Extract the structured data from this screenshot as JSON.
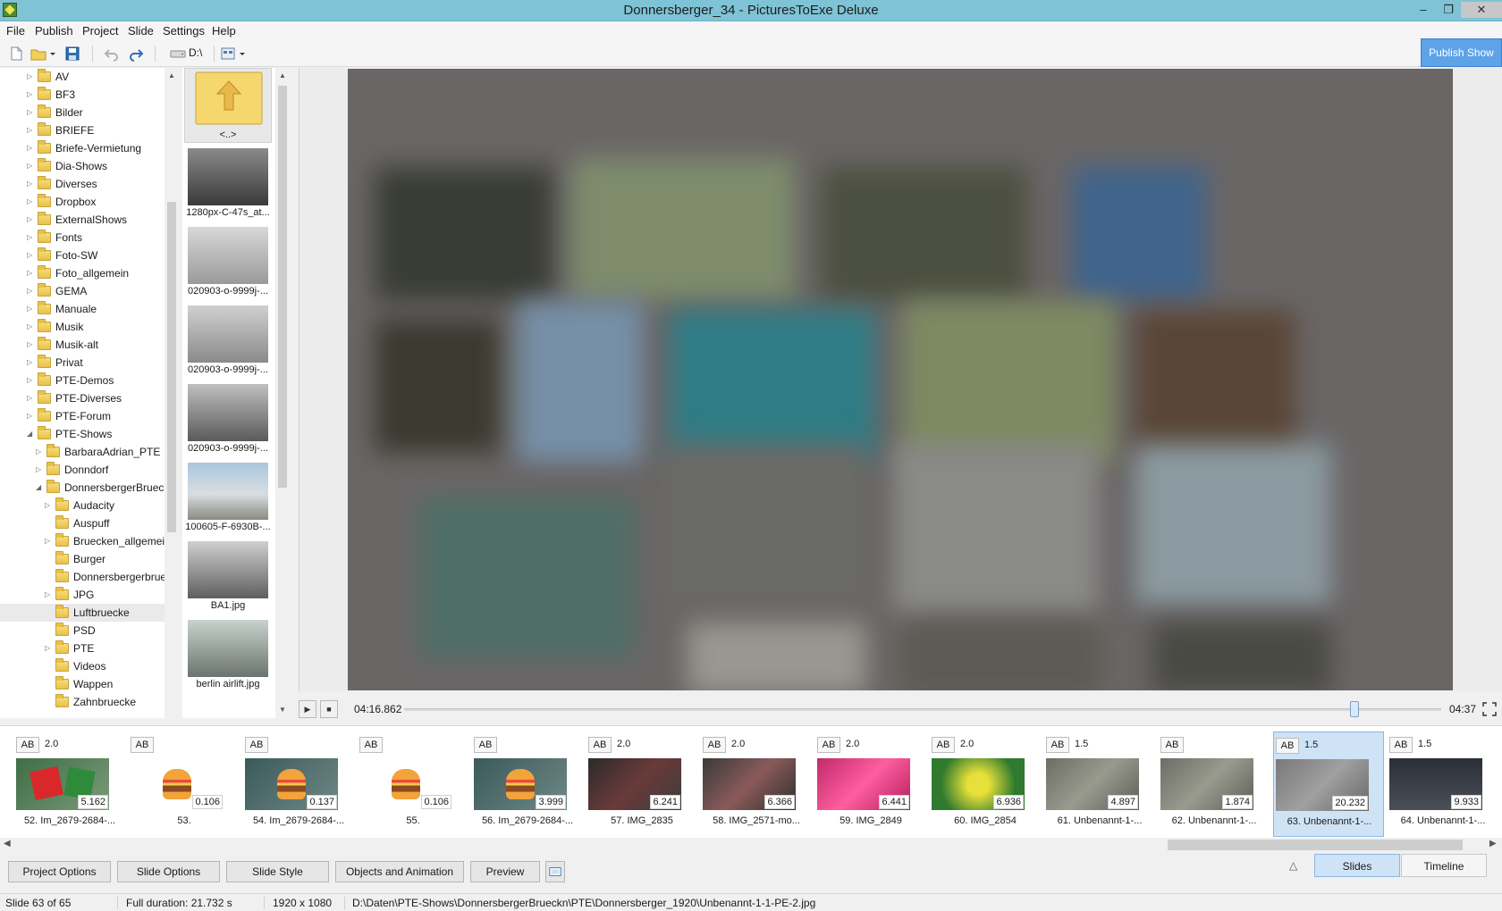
{
  "window": {
    "title": "Donnersberger_34 - PicturesToExe Deluxe",
    "minimize": "–",
    "restore": "❐",
    "close": "✕"
  },
  "menu": [
    "File",
    "Publish",
    "Project",
    "Slide",
    "Settings",
    "Help"
  ],
  "toolbar": {
    "drive": "D:\\",
    "publish_label": "Publish Show"
  },
  "tree": {
    "items": [
      {
        "label": "AV",
        "indent": 0,
        "expandable": true
      },
      {
        "label": "BF3",
        "indent": 0,
        "expandable": true
      },
      {
        "label": "Bilder",
        "indent": 0,
        "expandable": true
      },
      {
        "label": "BRIEFE",
        "indent": 0,
        "expandable": true
      },
      {
        "label": "Briefe-Vermietung",
        "indent": 0,
        "expandable": true
      },
      {
        "label": "Dia-Shows",
        "indent": 0,
        "expandable": true
      },
      {
        "label": "Diverses",
        "indent": 0,
        "expandable": true
      },
      {
        "label": "Dropbox",
        "indent": 0,
        "expandable": true
      },
      {
        "label": "ExternalShows",
        "indent": 0,
        "expandable": true
      },
      {
        "label": "Fonts",
        "indent": 0,
        "expandable": true
      },
      {
        "label": "Foto-SW",
        "indent": 0,
        "expandable": true
      },
      {
        "label": "Foto_allgemein",
        "indent": 0,
        "expandable": true
      },
      {
        "label": "GEMA",
        "indent": 0,
        "expandable": true
      },
      {
        "label": "Manuale",
        "indent": 0,
        "expandable": true
      },
      {
        "label": "Musik",
        "indent": 0,
        "expandable": true
      },
      {
        "label": "Musik-alt",
        "indent": 0,
        "expandable": true
      },
      {
        "label": "Privat",
        "indent": 0,
        "expandable": true
      },
      {
        "label": "PTE-Demos",
        "indent": 0,
        "expandable": true
      },
      {
        "label": "PTE-Diverses",
        "indent": 0,
        "expandable": true
      },
      {
        "label": "PTE-Forum",
        "indent": 0,
        "expandable": true
      },
      {
        "label": "PTE-Shows",
        "indent": 0,
        "expandable": true,
        "expanded": true
      },
      {
        "label": "BarbaraAdrian_PTE",
        "indent": 1,
        "expandable": true
      },
      {
        "label": "Donndorf",
        "indent": 1,
        "expandable": true
      },
      {
        "label": "DonnersbergerBrueck",
        "indent": 1,
        "expandable": true,
        "expanded": true
      },
      {
        "label": "Audacity",
        "indent": 2,
        "expandable": true
      },
      {
        "label": "Auspuff",
        "indent": 2,
        "expandable": false
      },
      {
        "label": "Bruecken_allgemeir",
        "indent": 2,
        "expandable": true
      },
      {
        "label": "Burger",
        "indent": 2,
        "expandable": false
      },
      {
        "label": "Donnersbergerbrue",
        "indent": 2,
        "expandable": false
      },
      {
        "label": "JPG",
        "indent": 2,
        "expandable": true
      },
      {
        "label": "Luftbruecke",
        "indent": 2,
        "expandable": false,
        "selected": true
      },
      {
        "label": "PSD",
        "indent": 2,
        "expandable": false
      },
      {
        "label": "PTE",
        "indent": 2,
        "expandable": true
      },
      {
        "label": "Videos",
        "indent": 2,
        "expandable": false
      },
      {
        "label": "Wappen",
        "indent": 2,
        "expandable": false
      },
      {
        "label": "Zahnbruecke",
        "indent": 2,
        "expandable": false
      }
    ]
  },
  "files": {
    "items": [
      {
        "name": "<..>",
        "kind": "up"
      },
      {
        "name": "1280px-C-47s_at...",
        "kind": "photo"
      },
      {
        "name": "020903-o-9999j-...",
        "kind": "photo"
      },
      {
        "name": "020903-o-9999j-...",
        "kind": "photo"
      },
      {
        "name": "020903-o-9999j-...",
        "kind": "photo"
      },
      {
        "name": "100605-F-6930B-...",
        "kind": "color"
      },
      {
        "name": "BA1.jpg",
        "kind": "photo"
      },
      {
        "name": "berlin airlift.jpg",
        "kind": "photo"
      }
    ]
  },
  "player": {
    "current_time": "04:16.862",
    "total_time": "04:37",
    "play": "▶",
    "stop": "■"
  },
  "slides": [
    {
      "name": "52. Im_2679-2684-...",
      "transition": "2.0",
      "duration": "5.162",
      "ab": "AB",
      "thumb": "mcdonalds"
    },
    {
      "name": "53.",
      "transition": "",
      "duration": "0.106",
      "ab": "AB",
      "thumb": "burger-white"
    },
    {
      "name": "54. Im_2679-2684-...",
      "transition": "",
      "duration": "0.137",
      "ab": "AB",
      "thumb": "burger-photo"
    },
    {
      "name": "55.",
      "transition": "",
      "duration": "0.106",
      "ab": "AB",
      "thumb": "burger-white"
    },
    {
      "name": "56. Im_2679-2684-...",
      "transition": "",
      "duration": "3.999",
      "ab": "AB",
      "thumb": "burger-photo"
    },
    {
      "name": "57. IMG_2835",
      "transition": "2.0",
      "duration": "6.241",
      "ab": "AB",
      "thumb": "graffiti-dark"
    },
    {
      "name": "58. IMG_2571-mo...",
      "transition": "2.0",
      "duration": "6.366",
      "ab": "AB",
      "thumb": "graffiti-face"
    },
    {
      "name": "59. IMG_2849",
      "transition": "2.0",
      "duration": "6.441",
      "ab": "AB",
      "thumb": "pink"
    },
    {
      "name": "60. IMG_2854",
      "transition": "2.0",
      "duration": "6.936",
      "ab": "AB",
      "thumb": "green-yellow"
    },
    {
      "name": "61. Unbenannt-1-...",
      "transition": "1.5",
      "duration": "4.897",
      "ab": "AB",
      "thumb": "aerial"
    },
    {
      "name": "62. Unbenannt-1-...",
      "transition": "",
      "duration": "1.874",
      "ab": "AB",
      "thumb": "aerial"
    },
    {
      "name": "63. Unbenannt-1-...",
      "transition": "1.5",
      "duration": "20.232",
      "ab": "AB",
      "thumb": "collage",
      "selected": true
    },
    {
      "name": "64. Unbenannt-1-...",
      "transition": "1.5",
      "duration": "9.933",
      "ab": "AB",
      "thumb": "text-dark"
    }
  ],
  "bottom_buttons": [
    "Project Options",
    "Slide Options",
    "Slide Style",
    "Objects and Animation",
    "Preview"
  ],
  "tabs": {
    "slides": "Slides",
    "timeline": "Timeline",
    "toggle": "△"
  },
  "status": {
    "slide": "Slide 63 of 65",
    "duration": "Full duration: 21.732 s",
    "resolution": "1920 x 1080",
    "path": "D:\\Daten\\PTE-Shows\\DonnersbergerBrueckn\\PTE\\Donnersberger_1920\\Unbenannt-1-1-PE-2.jpg"
  }
}
